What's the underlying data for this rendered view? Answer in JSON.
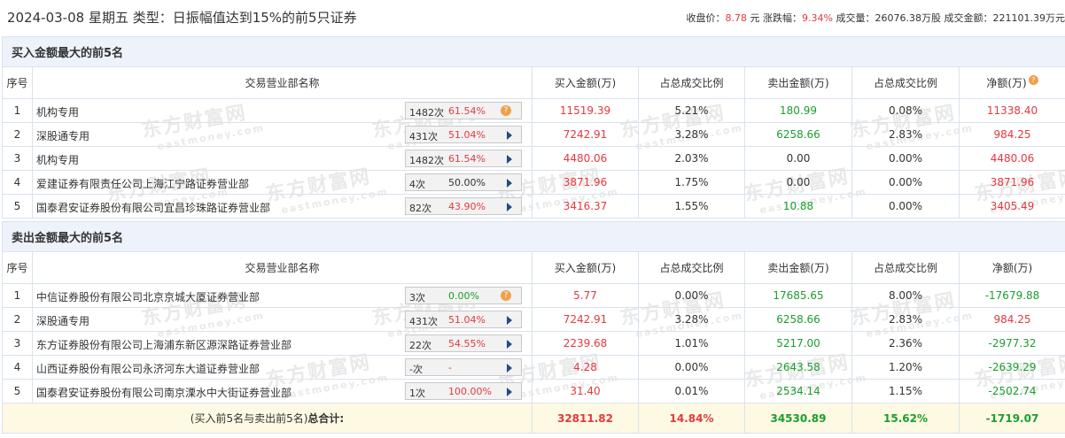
{
  "header": {
    "title": "2024-03-08 星期五 类型：日振幅值达到15%的前5只证券",
    "close_label": "收盘价：",
    "close_value": "8.78",
    "close_unit": "元",
    "change_label": "涨跌幅：",
    "change_value": "9.34%",
    "volume_label": "成交量：",
    "volume_value": "26076.38万股",
    "amount_label": "成交金额：",
    "amount_value": "221101.39万元"
  },
  "watermark": {
    "cn": "东方财富网",
    "en": "eastmoney.com"
  },
  "columns": {
    "idx": "序号",
    "name": "交易营业部名称",
    "buy": "买入金额(万)",
    "buy_ratio": "占总成交比例",
    "sell": "卖出金额(万)",
    "sell_ratio": "占总成交比例",
    "net": "净额(万)",
    "help_icon": "?"
  },
  "buy_section": {
    "title": "买入金额最大的前5名",
    "rows": [
      {
        "idx": "1",
        "name": "机构专用",
        "count": "1482次",
        "pct": "61.54%",
        "badge_icon": "question-icon",
        "buy": "11519.39",
        "buy_ratio": "5.21%",
        "sell": "180.99",
        "sell_ratio": "0.08%",
        "net": "11338.40"
      },
      {
        "idx": "2",
        "name": "深股通专用",
        "count": "431次",
        "pct": "51.04%",
        "badge_icon": "arrow-icon",
        "buy": "7242.91",
        "buy_ratio": "3.28%",
        "sell": "6258.66",
        "sell_ratio": "2.83%",
        "net": "984.25"
      },
      {
        "idx": "3",
        "name": "机构专用",
        "count": "1482次",
        "pct": "61.54%",
        "badge_icon": "arrow-icon",
        "buy": "4480.06",
        "buy_ratio": "2.03%",
        "sell": "0.00",
        "sell_ratio": "0.00%",
        "net": "4480.06"
      },
      {
        "idx": "4",
        "name": "爱建证券有限责任公司上海江宁路证券营业部",
        "count": "4次",
        "pct": "50.00%",
        "badge_icon": "arrow-icon",
        "buy": "3871.96",
        "buy_ratio": "1.75%",
        "sell": "0.00",
        "sell_ratio": "0.00%",
        "net": "3871.96"
      },
      {
        "idx": "5",
        "name": "国泰君安证券股份有限公司宜昌珍珠路证券营业部",
        "count": "82次",
        "pct": "43.90%",
        "badge_icon": "arrow-icon",
        "buy": "3416.37",
        "buy_ratio": "1.55%",
        "sell": "10.88",
        "sell_ratio": "0.00%",
        "net": "3405.49"
      }
    ]
  },
  "sell_section": {
    "title": "卖出金额最大的前5名",
    "rows": [
      {
        "idx": "1",
        "name": "中信证券股份有限公司北京京城大厦证券营业部",
        "count": "3次",
        "pct": "0.00%",
        "badge_icon": "question-icon",
        "buy": "5.77",
        "buy_ratio": "0.00%",
        "sell": "17685.65",
        "sell_ratio": "8.00%",
        "net": "-17679.88"
      },
      {
        "idx": "2",
        "name": "深股通专用",
        "count": "431次",
        "pct": "51.04%",
        "badge_icon": "arrow-icon",
        "buy": "7242.91",
        "buy_ratio": "3.28%",
        "sell": "6258.66",
        "sell_ratio": "2.83%",
        "net": "984.25"
      },
      {
        "idx": "3",
        "name": "东方证券股份有限公司上海浦东新区源深路证券营业部",
        "count": "22次",
        "pct": "54.55%",
        "badge_icon": "arrow-icon",
        "buy": "2239.68",
        "buy_ratio": "1.01%",
        "sell": "5217.00",
        "sell_ratio": "2.36%",
        "net": "-2977.32"
      },
      {
        "idx": "4",
        "name": "山西证券股份有限公司永济河东大道证券营业部",
        "count": "-次",
        "pct": "-",
        "badge_icon": "arrow-icon",
        "buy": "4.28",
        "buy_ratio": "0.00%",
        "sell": "2643.58",
        "sell_ratio": "1.20%",
        "net": "-2639.29"
      },
      {
        "idx": "5",
        "name": "国泰君安证券股份有限公司南京溧水中大街证券营业部",
        "count": "1次",
        "pct": "100.00%",
        "badge_icon": "arrow-icon",
        "buy": "31.40",
        "buy_ratio": "0.01%",
        "sell": "2534.14",
        "sell_ratio": "1.15%",
        "net": "-2502.74"
      }
    ]
  },
  "total": {
    "label_prefix": "(买入前5名与卖出前5名)",
    "label_suffix": "总合计:",
    "buy": "32811.82",
    "buy_ratio": "14.84%",
    "sell": "34530.89",
    "sell_ratio": "15.62%",
    "net": "-1719.07"
  },
  "colors": {
    "up": "#e4393c",
    "down": "#1a9f2c",
    "section_bg": "#eef3fb",
    "total_bg": "#fdf9e3",
    "border": "#d9e2ef",
    "arrow": "#234b8a",
    "help": "#f0a04b"
  }
}
